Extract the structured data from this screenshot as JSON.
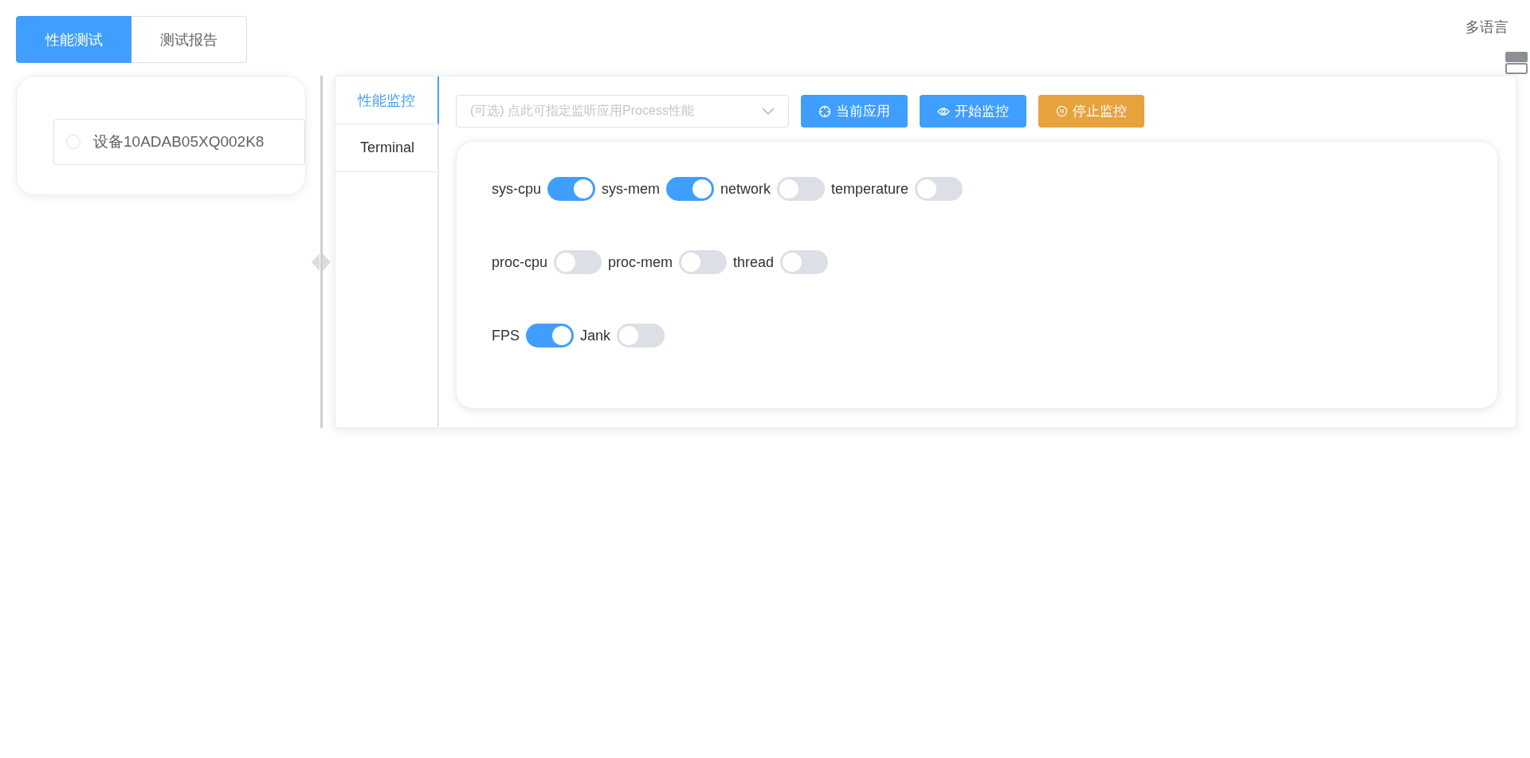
{
  "top_tabs": [
    {
      "label": "性能测试",
      "selected": true
    },
    {
      "label": "测试报告",
      "selected": false
    }
  ],
  "language_menu": "多语言",
  "devices": [
    {
      "label": "设备10ADAB05XQ002K8",
      "selected": false
    }
  ],
  "side_tabs": [
    {
      "label": "性能监控",
      "selected": true
    },
    {
      "label": "Terminal",
      "selected": false
    }
  ],
  "toolbar": {
    "process_select": {
      "placeholder": "(可选) 点此可指定监听应用Process性能"
    },
    "buttons": [
      {
        "label": "当前应用",
        "kind": "target",
        "color": "#409eff"
      },
      {
        "label": "开始监控",
        "kind": "eye",
        "color": "#409eff"
      },
      {
        "label": "停止监控",
        "kind": "pause",
        "color": "#e6a23c"
      }
    ]
  },
  "switch_rows": [
    [
      {
        "label": "sys-cpu",
        "on": true
      },
      {
        "label": "sys-mem",
        "on": true
      },
      {
        "label": "network",
        "on": false
      },
      {
        "label": "temperature",
        "on": false
      }
    ],
    [
      {
        "label": "proc-cpu",
        "on": false
      },
      {
        "label": "proc-mem",
        "on": false
      },
      {
        "label": "thread",
        "on": false
      }
    ],
    [
      {
        "label": "FPS",
        "on": true
      },
      {
        "label": "Jank",
        "on": false
      }
    ]
  ]
}
